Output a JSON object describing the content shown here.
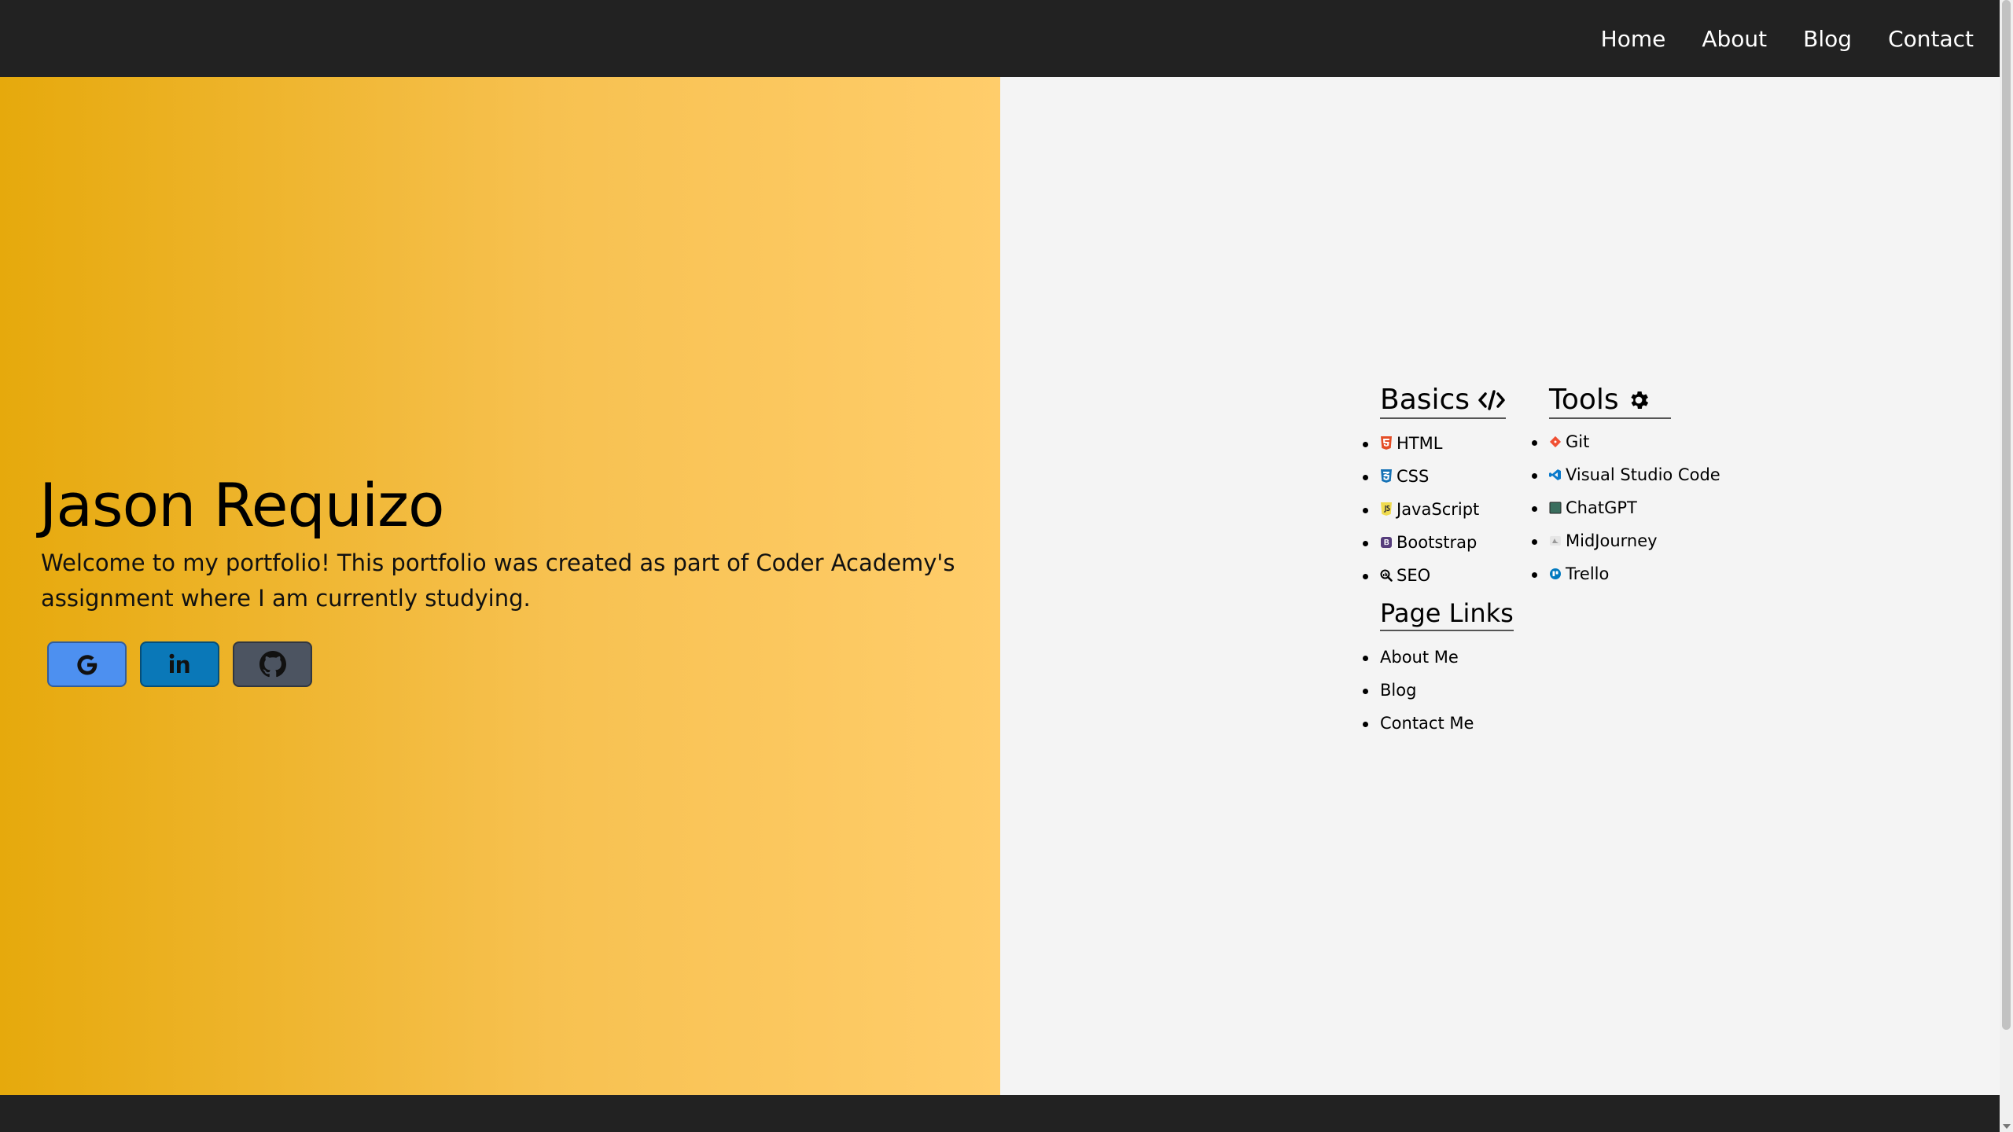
{
  "nav": {
    "links": [
      "Home",
      "About",
      "Blog",
      "Contact"
    ]
  },
  "hero": {
    "name": "Jason Requizo",
    "intro": "Welcome to my portfolio! This portfolio was created as part of Coder Academy's assignment where I am currently studying.",
    "socials": [
      {
        "icon": "google-icon",
        "color": "#4d90f0"
      },
      {
        "icon": "linkedin-icon",
        "color": "#0a78b8"
      },
      {
        "icon": "github-icon",
        "color": "#4c5461"
      }
    ]
  },
  "basics": {
    "heading": "Basics",
    "heading_icon": "code-icon",
    "items": [
      {
        "label": "HTML",
        "icon": "html5-icon"
      },
      {
        "label": "CSS",
        "icon": "css3-icon"
      },
      {
        "label": "JavaScript",
        "icon": "javascript-icon"
      },
      {
        "label": "Bootstrap",
        "icon": "bootstrap-icon"
      },
      {
        "label": "SEO",
        "icon": "seo-icon"
      }
    ]
  },
  "page_links": {
    "heading": "Page Links",
    "items": [
      "About Me",
      "Blog",
      "Contact Me"
    ]
  },
  "tools": {
    "heading": "Tools",
    "heading_icon": "gear-icon",
    "items": [
      {
        "label": "Git",
        "icon": "git-icon"
      },
      {
        "label": "Visual Studio Code",
        "icon": "vscode-icon"
      },
      {
        "label": "ChatGPT",
        "icon": "chatgpt-icon"
      },
      {
        "label": "MidJourney",
        "icon": "midjourney-icon"
      },
      {
        "label": "Trello",
        "icon": "trello-icon"
      }
    ]
  },
  "colors": {
    "nav_bg": "#222222",
    "hero_gradient_start": "#e6a90c",
    "hero_gradient_end": "#ffcd6b",
    "panel_bg": "#f4f4f4"
  }
}
